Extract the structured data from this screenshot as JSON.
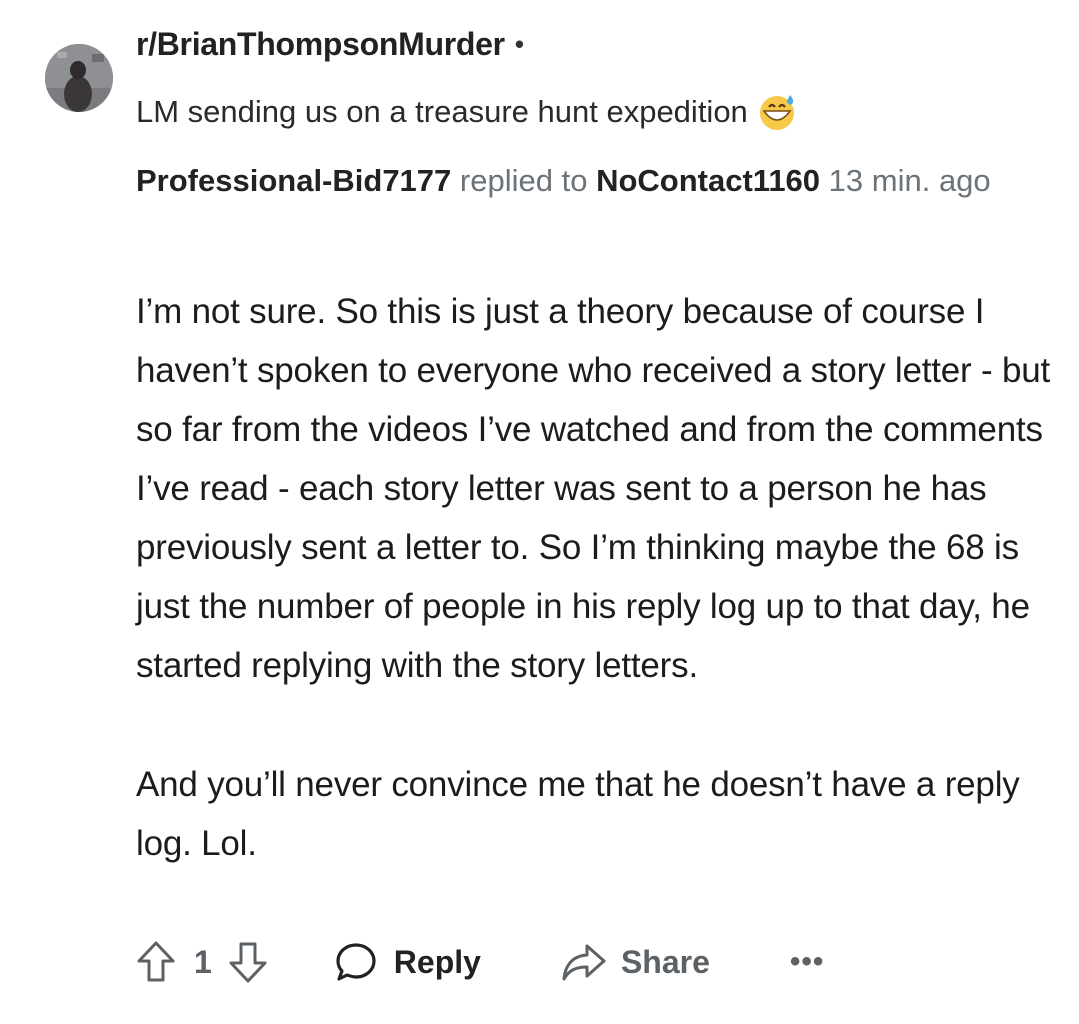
{
  "header": {
    "subreddit": "r/BrianThompsonMurder",
    "separator": "•",
    "post_title": "LM sending us on a treasure hunt expedition"
  },
  "reply_meta": {
    "author": "Professional-Bid7177",
    "replied_to_text": "replied to",
    "parent_author": "NoContact1160",
    "time_ago": "13 min. ago"
  },
  "comment": {
    "paragraph_1": "I’m not sure. So this is just a theory because of course I haven’t spoken to everyone who received a story letter - but so far from the videos I’ve watched and from the comments I’ve read - each story letter was sent to a person he has previously sent a letter to. So I’m thinking maybe the 68 is just the number of people in his reply log up to that day, he started replying with the story letters.",
    "paragraph_2": "And you’ll never convince me that he doesn’t have a reply log. Lol."
  },
  "actions": {
    "upvote_icon": "arrow-up-icon",
    "vote_count": "1",
    "downvote_icon": "arrow-down-icon",
    "reply_label": "Reply",
    "reply_icon": "speech-bubble-icon",
    "share_label": "Share",
    "share_icon": "share-arrow-icon",
    "more_label": "•••"
  },
  "icons": {
    "title_emoji": "grinning-face-with-sweat-emoji"
  }
}
